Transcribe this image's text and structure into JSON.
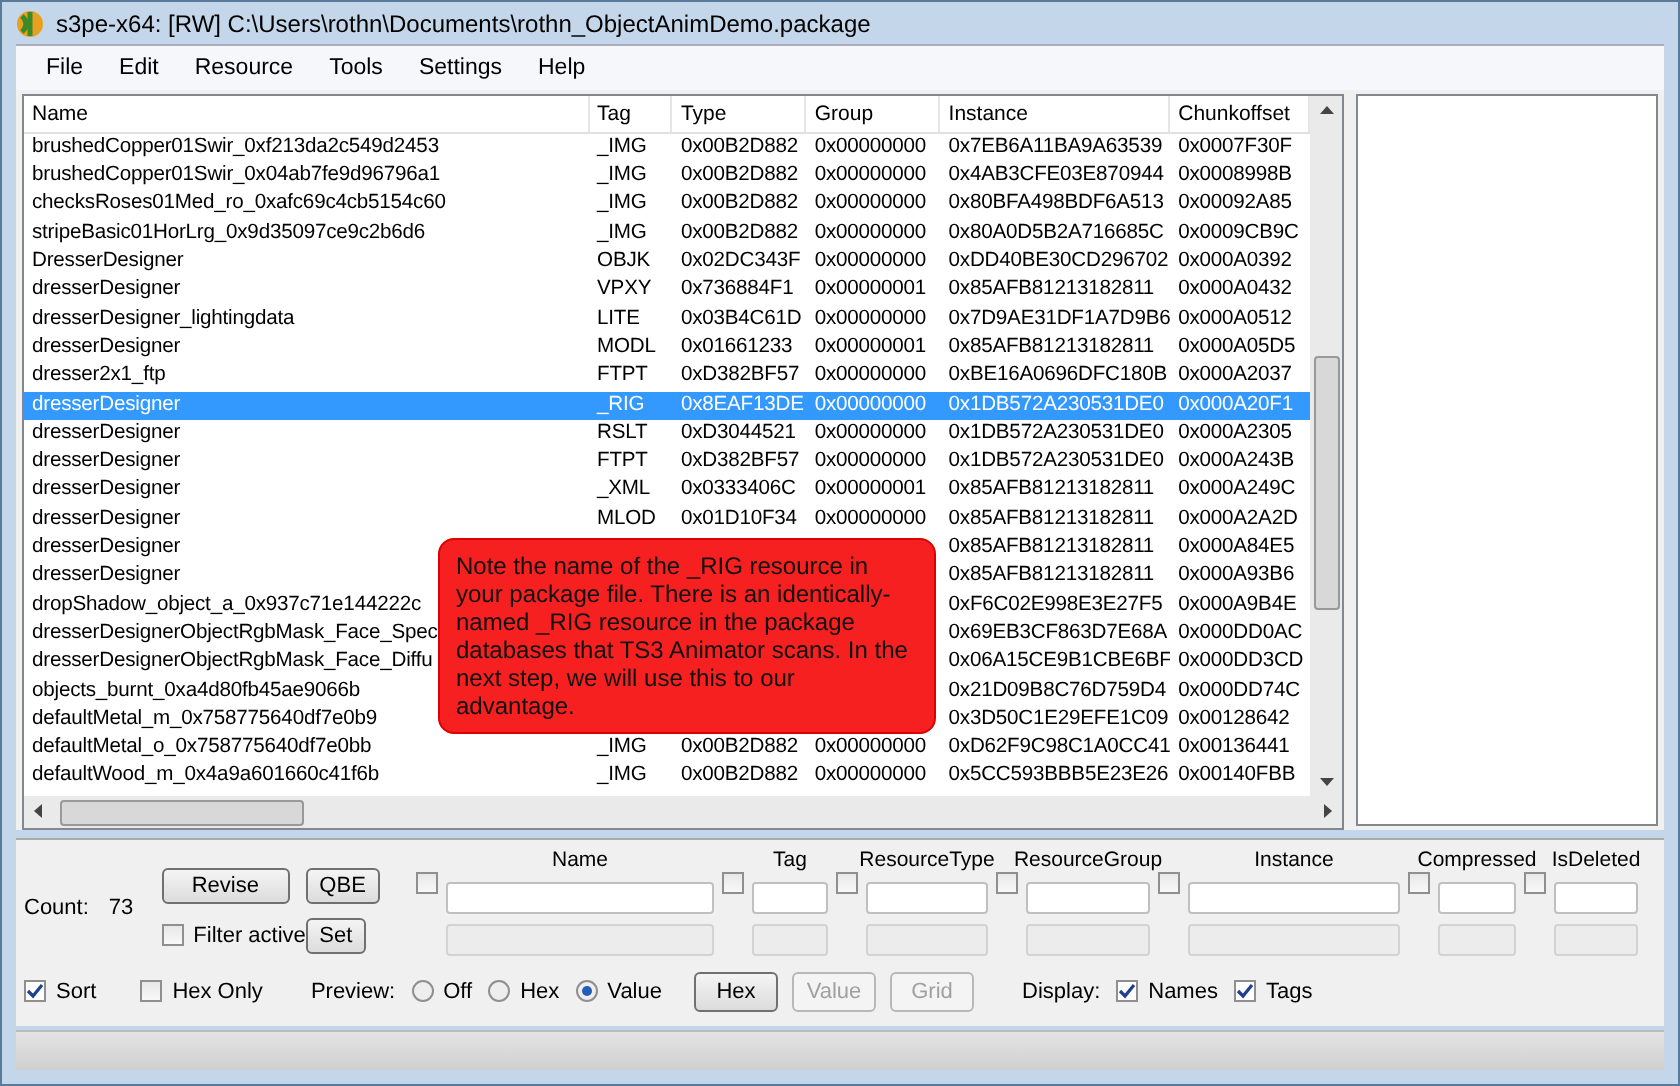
{
  "window": {
    "title": "s3pe-x64: [RW] C:\\Users\\rothn\\Documents\\rothn_ObjectAnimDemo.package"
  },
  "menu": [
    "File",
    "Edit",
    "Resource",
    "Tools",
    "Settings",
    "Help"
  ],
  "table": {
    "columns": [
      "Name",
      "Tag",
      "Type",
      "Group",
      "Instance",
      "Chunkoffset"
    ],
    "rows": [
      {
        "selected": false,
        "cells": [
          "brushedCopper01Swir_0xf213da2c549d2453",
          "_IMG",
          "0x00B2D882",
          "0x00000000",
          "0x7EB6A11BA9A63539",
          "0x0007F30F"
        ]
      },
      {
        "selected": false,
        "cells": [
          "brushedCopper01Swir_0x04ab7fe9d96796a1",
          "_IMG",
          "0x00B2D882",
          "0x00000000",
          "0x4AB3CFE03E870944",
          "0x0008998B"
        ]
      },
      {
        "selected": false,
        "cells": [
          "checksRoses01Med_ro_0xafc69c4cb5154c60",
          "_IMG",
          "0x00B2D882",
          "0x00000000",
          "0x80BFA498BDF6A513",
          "0x00092A85"
        ]
      },
      {
        "selected": false,
        "cells": [
          "stripeBasic01HorLrg_0x9d35097ce9c2b6d6",
          "_IMG",
          "0x00B2D882",
          "0x00000000",
          "0x80A0D5B2A716685C",
          "0x0009CB9C"
        ]
      },
      {
        "selected": false,
        "cells": [
          "DresserDesigner",
          "OBJK",
          "0x02DC343F",
          "0x00000000",
          "0xDD40BE30CD296702",
          "0x000A0392"
        ]
      },
      {
        "selected": false,
        "cells": [
          "dresserDesigner",
          "VPXY",
          "0x736884F1",
          "0x00000001",
          "0x85AFB81213182811",
          "0x000A0432"
        ]
      },
      {
        "selected": false,
        "cells": [
          "dresserDesigner_lightingdata",
          "LITE",
          "0x03B4C61D",
          "0x00000000",
          "0x7D9AE31DF1A7D9B6",
          "0x000A0512"
        ]
      },
      {
        "selected": false,
        "cells": [
          "dresserDesigner",
          "MODL",
          "0x01661233",
          "0x00000001",
          "0x85AFB81213182811",
          "0x000A05D5"
        ]
      },
      {
        "selected": false,
        "cells": [
          "dresser2x1_ftp",
          "FTPT",
          "0xD382BF57",
          "0x00000000",
          "0xBE16A0696DFC180B",
          "0x000A2037"
        ]
      },
      {
        "selected": true,
        "cells": [
          "dresserDesigner",
          "_RIG",
          "0x8EAF13DE",
          "0x00000000",
          "0x1DB572A230531DE0",
          "0x000A20F1"
        ]
      },
      {
        "selected": false,
        "cells": [
          "dresserDesigner",
          "RSLT",
          "0xD3044521",
          "0x00000000",
          "0x1DB572A230531DE0",
          "0x000A2305"
        ]
      },
      {
        "selected": false,
        "cells": [
          "dresserDesigner",
          "FTPT",
          "0xD382BF57",
          "0x00000000",
          "0x1DB572A230531DE0",
          "0x000A243B"
        ]
      },
      {
        "selected": false,
        "cells": [
          "dresserDesigner",
          "_XML",
          "0x0333406C",
          "0x00000001",
          "0x85AFB81213182811",
          "0x000A249C"
        ]
      },
      {
        "selected": false,
        "cells": [
          "dresserDesigner",
          "MLOD",
          "0x01D10F34",
          "0x00000000",
          "0x85AFB81213182811",
          "0x000A2A2D"
        ]
      },
      {
        "selected": false,
        "cells": [
          "dresserDesigner",
          null,
          null,
          null,
          "0x85AFB81213182811",
          "0x000A84E5"
        ]
      },
      {
        "selected": false,
        "cells": [
          "dresserDesigner",
          null,
          null,
          null,
          "0x85AFB81213182811",
          "0x000A93B6"
        ]
      },
      {
        "selected": false,
        "cells": [
          "dropShadow_object_a_0x937c71e144222c",
          null,
          null,
          null,
          "0xF6C02E998E3E27F5",
          "0x000A9B4E"
        ]
      },
      {
        "selected": false,
        "cells": [
          "dresserDesignerObjectRgbMask_Face_Spec",
          null,
          null,
          null,
          "0x69EB3CF863D7E68A",
          "0x000DD0AC"
        ]
      },
      {
        "selected": false,
        "cells": [
          "dresserDesignerObjectRgbMask_Face_Diffu",
          null,
          null,
          null,
          "0x06A15CE9B1CBE6BF",
          "0x000DD3CD"
        ]
      },
      {
        "selected": false,
        "cells": [
          "objects_burnt_0xa4d80fb45ae9066b",
          null,
          null,
          null,
          "0x21D09B8C76D759D4",
          "0x000DD74C"
        ]
      },
      {
        "selected": false,
        "cells": [
          "defaultMetal_m_0x758775640df7e0b9",
          null,
          null,
          null,
          "0x3D50C1E29EFE1C09",
          "0x00128642"
        ]
      },
      {
        "selected": false,
        "cells": [
          "defaultMetal_o_0x758775640df7e0bb",
          "_IMG",
          "0x00B2D882",
          "0x00000000",
          "0xD62F9C98C1A0CC41",
          "0x00136441"
        ]
      },
      {
        "selected": false,
        "cells": [
          "defaultWood_m_0x4a9a601660c41f6b",
          "_IMG",
          "0x00B2D882",
          "0x00000000",
          "0x5CC593BBB5E23E26",
          "0x00140FBB"
        ]
      }
    ]
  },
  "callout": {
    "text": "Note the name of the _RIG resource in your package file. There is an identically-named _RIG resource in the package databases that TS3 Animator scans. In the next step, we will use this to our advantage."
  },
  "filter": {
    "count_label": "Count:",
    "count": "73",
    "revise_button": "Revise",
    "qbe_button": "QBE",
    "set_button": "Set",
    "filter_active": {
      "label": "Filter active",
      "checked": false
    },
    "fields": [
      {
        "label": "Name",
        "checked": false
      },
      {
        "label": "Tag",
        "checked": false
      },
      {
        "label": "ResourceType",
        "checked": false
      },
      {
        "label": "ResourceGroup",
        "checked": false
      },
      {
        "label": "Instance",
        "checked": false
      },
      {
        "label": "Compressed",
        "checked": false
      },
      {
        "label": "IsDeleted",
        "checked": false
      }
    ]
  },
  "options": {
    "sort": {
      "label": "Sort",
      "checked": true
    },
    "hex_only": {
      "label": "Hex Only",
      "checked": false
    },
    "preview": {
      "label": "Preview:",
      "options": [
        {
          "label": "Off",
          "selected": false
        },
        {
          "label": "Hex",
          "selected": false
        },
        {
          "label": "Value",
          "selected": true
        }
      ]
    },
    "view_buttons": [
      {
        "label": "Hex",
        "disabled": false
      },
      {
        "label": "Value",
        "disabled": true
      },
      {
        "label": "Grid",
        "disabled": true
      }
    ],
    "display": {
      "label": "Display:",
      "options": [
        {
          "label": "Names",
          "checked": true
        },
        {
          "label": "Tags",
          "checked": true
        }
      ]
    }
  }
}
